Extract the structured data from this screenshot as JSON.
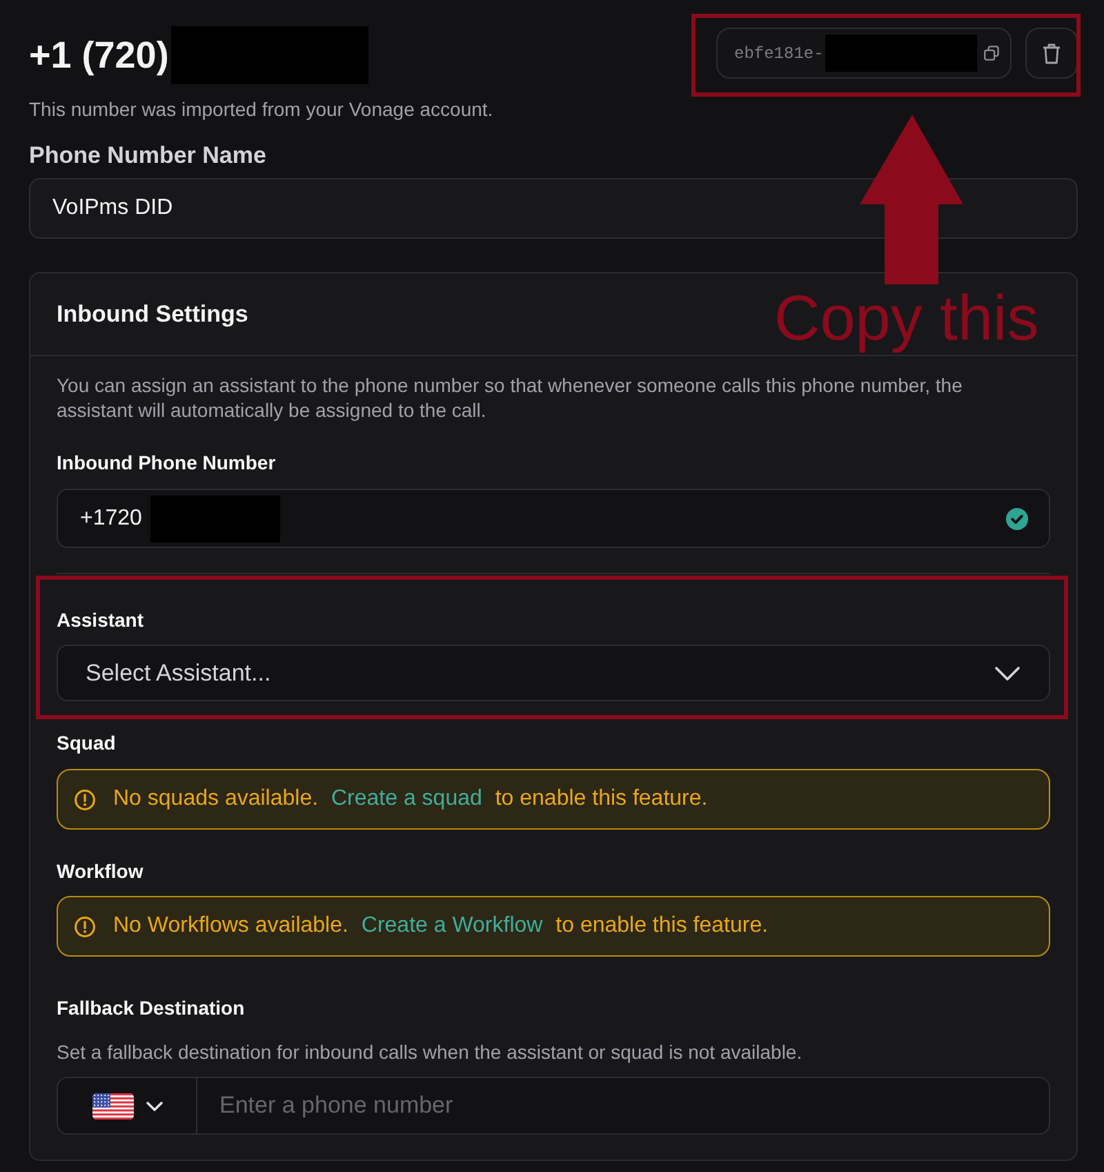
{
  "header": {
    "title": {
      "text": "+1 (720)",
      "redacted": true
    },
    "id_chip": {
      "text": "ebfe181e-",
      "redacted": true
    },
    "subtitle": "This number was imported from your Vonage account."
  },
  "name_field": {
    "label": "Phone Number Name",
    "value": "VoIPms DID"
  },
  "inbound_settings": {
    "title": "Inbound Settings",
    "description": "You can assign an assistant to the phone number so that whenever someone calls this phone number, the assistant will automatically be assigned to the call.",
    "inbound_number": {
      "label": "Inbound Phone Number",
      "value": "+1720",
      "redacted": true,
      "verified": true
    },
    "assistant": {
      "label": "Assistant",
      "placeholder": "Select Assistant..."
    },
    "notices": [
      {
        "label": "Squad",
        "message": "No squads available.",
        "link": "Create a squad",
        "suffix": "to enable this feature."
      },
      {
        "label": "Workflow",
        "message": "No Workflows available.",
        "link": "Create a Workflow",
        "suffix": "to enable this feature."
      }
    ],
    "fallback": {
      "label": "Fallback Destination",
      "description": "Set a fallback destination for inbound calls when the assistant or squad is not available.",
      "placeholder": "Enter a phone number"
    }
  },
  "annotation": {
    "label": "Copy this"
  }
}
